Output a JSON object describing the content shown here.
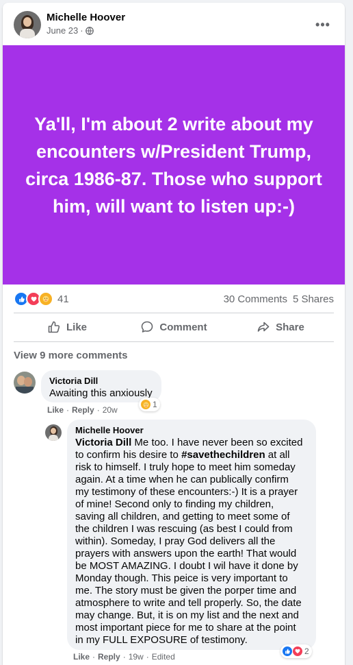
{
  "post": {
    "author": "Michelle Hoover",
    "date": "June 23",
    "date_sep": "·",
    "privacy_icon": "globe-icon",
    "menu_icon": "more-options-icon",
    "banner_text": "Ya'll, I'm about 2 write about my encounters w/President Trump, circa 1986-87. Those who support him, will want to listen up:-)",
    "banner_color": "#a531e8",
    "reaction_count": "41",
    "comments_count": "30 Comments",
    "shares_count": "5 Shares"
  },
  "actions": {
    "like": "Like",
    "comment": "Comment",
    "share": "Share"
  },
  "view_more": "View 9 more comments",
  "comments": [
    {
      "author": "Victoria Dill",
      "text": "Awaiting this anxiously",
      "like": "Like",
      "reply": "Reply",
      "time": "20w",
      "reaction_count": "1"
    },
    {
      "author": "Michelle Hoover",
      "tag": "Victoria Dill",
      "hashtag": "#savethechildren",
      "text_line1": " Me too. I have never been so excited",
      "text_line2": "to confirm his desire to ",
      "text_rest": " at all\nrisk to himself. I truly hope to meet him someday\nagain. At a time when he can publically confirm\nmy testimony of these encounters:-) It is a prayer\nof mine! Second only to finding my children,\nsaving all children, and getting to meet some of\nthe children I was rescuing (as best I could from\nwithin). Someday, I pray God delivers all the\nprayers with answers upon the earth! That would\nbe MOST AMAZING. I doubt I wil have it done by\nMonday though. This peice is very important to\nme. The story must be given the porper time and\natmosphere to write and tell properly. So, the date\nmay change. But, it is on my list and the next and\nmost important piece for me to share at the point\nin my FULL EXPOSURE of testimony.",
      "like": "Like",
      "reply": "Reply",
      "time": "19w",
      "edited": "Edited",
      "reaction_count": "2"
    }
  ]
}
